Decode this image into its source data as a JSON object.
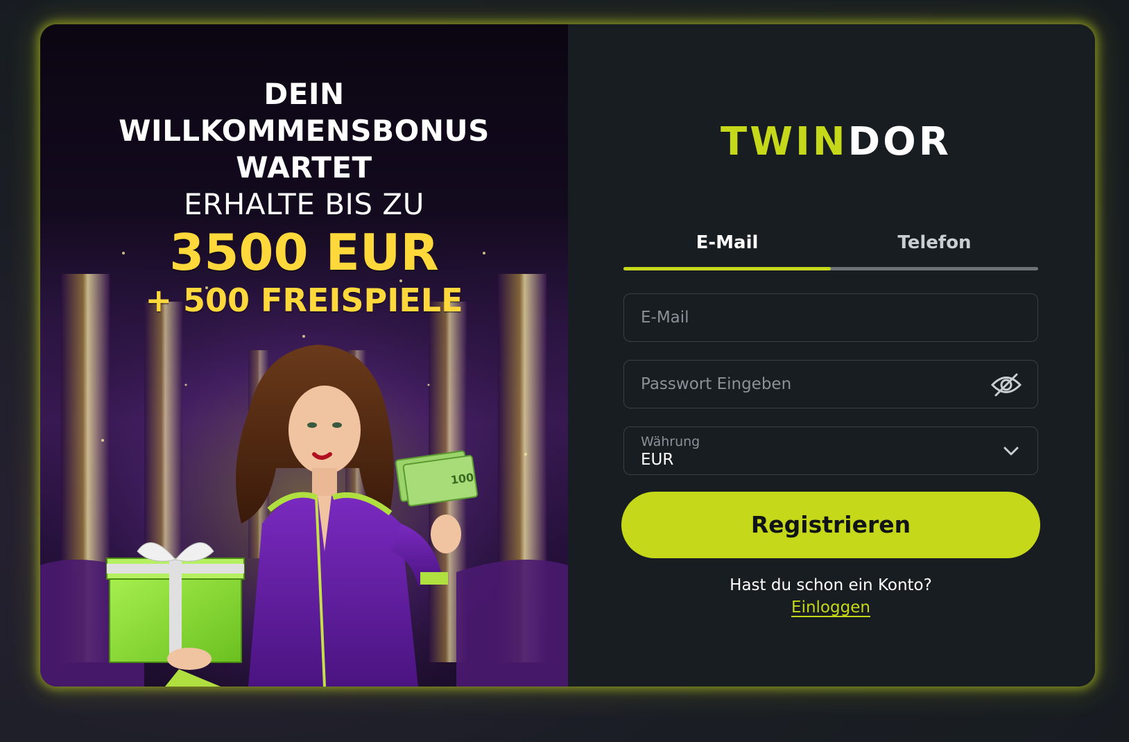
{
  "promo": {
    "headline_1": "DEIN",
    "headline_2": "WILLKOMMENSBONUS",
    "headline_3": "WARTET",
    "subline": "ERHALTE BIS ZU",
    "amount": "3500 EUR",
    "spins": "+ 500 FREISPIELE",
    "banknote_label": "100"
  },
  "brand": {
    "logo_part_1": "TWIN",
    "logo_part_2": "DOR",
    "accent_color": "#c5d91a"
  },
  "tabs": [
    {
      "label": "E-Mail",
      "active": true
    },
    {
      "label": "Telefon",
      "active": false
    }
  ],
  "form": {
    "email_placeholder": "E-Mail",
    "password_placeholder": "Passwort Eingeben",
    "password_toggle_icon": "eye-off-icon",
    "currency_label": "Währung",
    "currency_value": "EUR",
    "currency_dropdown_icon": "chevron-down-icon",
    "submit_label": "Registrieren"
  },
  "login": {
    "prompt": "Hast du schon ein Konto?",
    "link_label": "Einloggen"
  }
}
